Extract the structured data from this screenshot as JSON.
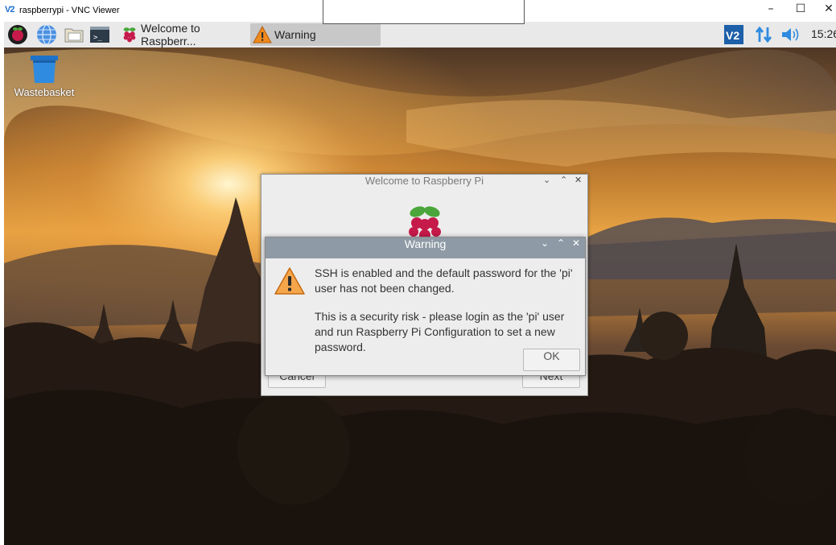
{
  "vnc": {
    "logo": "V2",
    "title": "raspberrypi - VNC Viewer",
    "minimize": "–",
    "maximize": "☐",
    "close": "✕"
  },
  "panel": {
    "tasks": [
      {
        "label": "Welcome to Raspberr...",
        "icon": "raspberry-icon"
      },
      {
        "label": "Warning",
        "icon": "warning-icon"
      }
    ],
    "clock": "15:26",
    "launchers": [
      "raspberry-menu-icon",
      "web-browser-icon",
      "file-manager-icon",
      "terminal-icon"
    ],
    "tray": [
      "vnc-server-icon",
      "network-icon",
      "volume-icon"
    ]
  },
  "desktop": {
    "icons": [
      {
        "label": "Wastebasket",
        "icon": "wastebasket-icon"
      }
    ]
  },
  "welcome_dialog": {
    "title": "Welcome to Raspberry Pi",
    "controls": {
      "minimize": "⌄",
      "maximize": "⌃",
      "close": "✕"
    },
    "cancel_label": "Cancel",
    "next_label": "Next"
  },
  "warning_dialog": {
    "title": "Warning",
    "controls": {
      "minimize": "⌄",
      "maximize": "⌃",
      "close": "✕"
    },
    "message_line1": "SSH is enabled and the default password for the 'pi' user has not been changed.",
    "message_line2": "This is a security risk - please login as the 'pi' user and run Raspberry Pi Configuration to set a new password.",
    "ok_label": "OK"
  },
  "colors": {
    "panel_bg": "#e9e9e9",
    "warning_titlebar": "#8e9aa5",
    "dialog_bg": "#ededed",
    "raspberry_red": "#c51a4a",
    "raspberry_green": "#4aa63a",
    "warning_orange": "#f08a1c"
  }
}
